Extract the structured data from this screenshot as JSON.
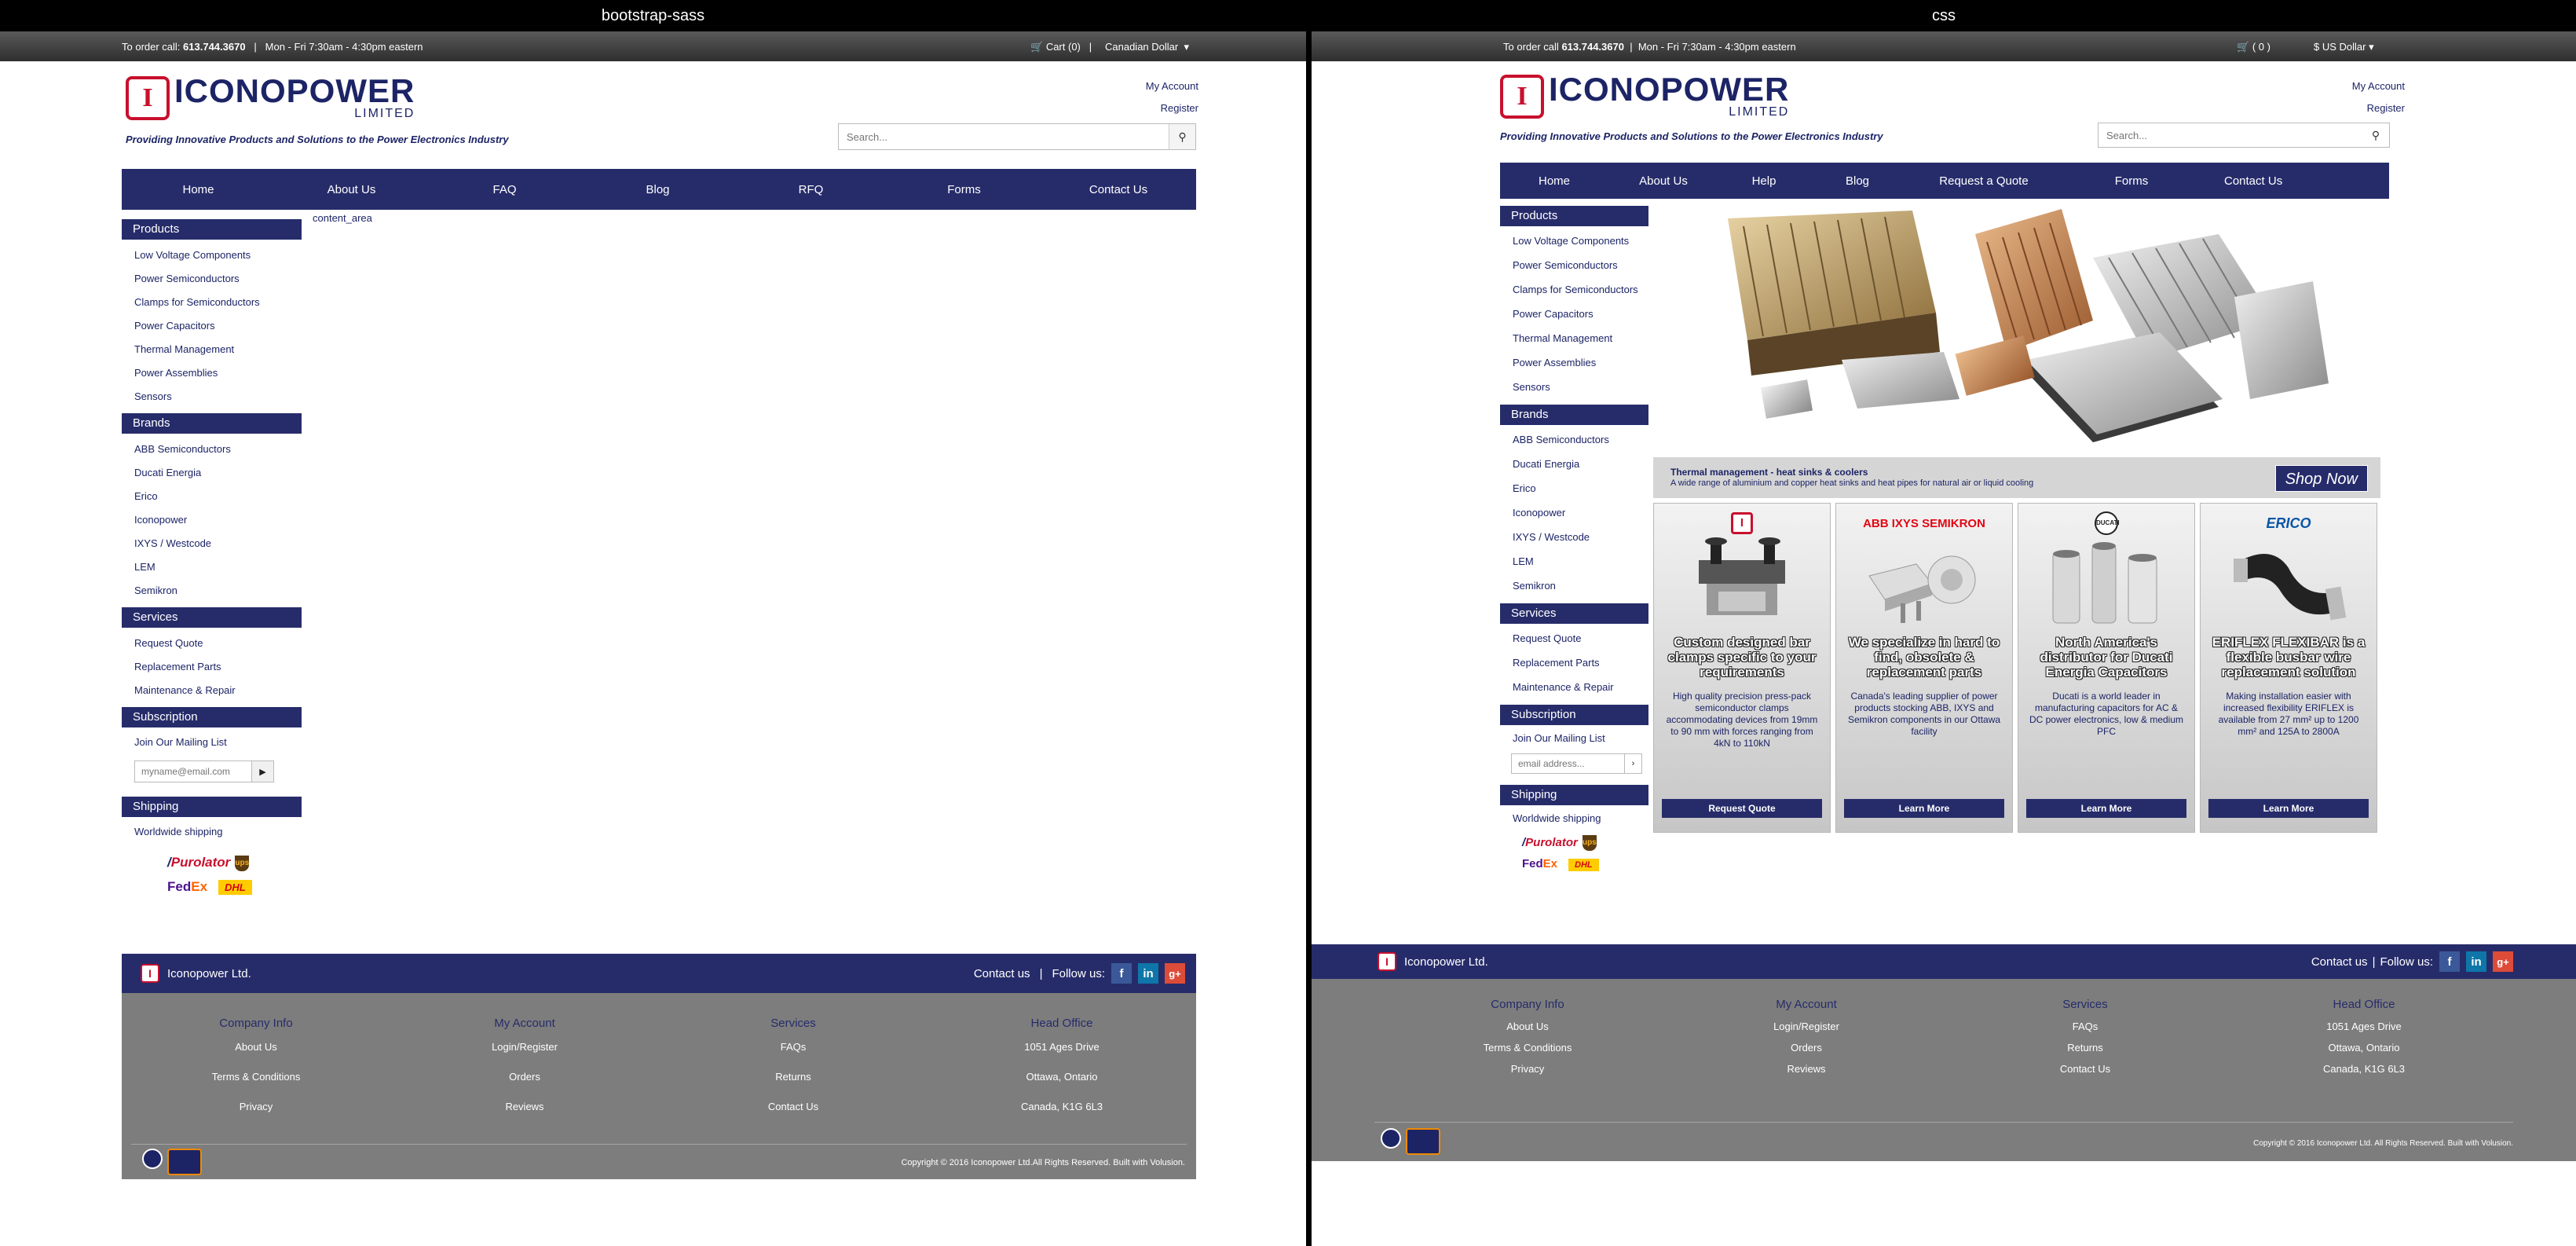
{
  "panels": [
    {
      "caption": "bootstrap-sass",
      "topbar": {
        "order_prefix": "To order call:",
        "phone": "613.744.3670",
        "sep": "|",
        "hours": "Mon - Fri   7:30am - 4:30pm eastern",
        "cart": "Cart (0)",
        "currency": "Canadian Dollar"
      },
      "logo": {
        "name": "ICONOPOWER",
        "sub": "LIMITED"
      },
      "tagline": "Providing Innovative Products and Solutions to the Power Electronics Industry",
      "account": {
        "my_account": "My Account",
        "register": "Register"
      },
      "search_placeholder": "Search...",
      "nav": [
        "Home",
        "About Us",
        "FAQ",
        "Blog",
        "RFQ",
        "Forms",
        "Contact Us"
      ],
      "content_placeholder": "content_area",
      "sidebar": {
        "products_title": "Products",
        "products": [
          "Low Voltage Components",
          "Power Semiconductors",
          "Clamps for Semiconductors",
          "Power Capacitors",
          "Thermal Management",
          "Power Assemblies",
          "Sensors"
        ],
        "brands_title": "Brands",
        "brands": [
          "ABB Semiconductors",
          "Ducati Energia",
          "Erico",
          "Iconopower",
          "IXYS / Westcode",
          "LEM",
          "Semikron"
        ],
        "services_title": "Services",
        "services": [
          "Request Quote",
          "Replacement Parts",
          "Maintenance & Repair"
        ],
        "subscription_title": "Subscription",
        "mailing_list": "Join Our Mailing List",
        "email_placeholder": "myname@email.com",
        "shipping_title": "Shipping",
        "shipping_text": "Worldwide shipping"
      },
      "footer": {
        "company": "Iconopower Ltd.",
        "contact": "Contact us",
        "sep": "|",
        "follow": "Follow us:",
        "columns": [
          {
            "title": "Company Info",
            "items": [
              "About Us",
              "Terms & Conditions",
              "Privacy"
            ]
          },
          {
            "title": "My Account",
            "items": [
              "Login/Register",
              "Orders",
              "Reviews"
            ]
          },
          {
            "title": "Services",
            "items": [
              "FAQs",
              "Returns",
              "Contact Us"
            ]
          },
          {
            "title": "Head Office",
            "items": [
              "1051 Ages Drive",
              "Ottawa, Ontario",
              "Canada, K1G 6L3"
            ]
          }
        ],
        "copyright": "Copyright © 2016 Iconopower Ltd.All Rights Reserved. Built with Volusion."
      }
    },
    {
      "caption": "css",
      "topbar": {
        "order_prefix": "To order call",
        "phone": "613.744.3670",
        "sep": "|",
        "hours": "Mon - Fri   7:30am - 4:30pm eastern",
        "cart": "( 0 )",
        "currency": "US Dollar"
      },
      "logo": {
        "name": "ICONOPOWER",
        "sub": "LIMITED"
      },
      "tagline": "Providing Innovative Products and Solutions to the Power Electronics Industry",
      "account": {
        "my_account": "My Account",
        "register": "Register"
      },
      "search_placeholder": "Search...",
      "nav": [
        "Home",
        "About Us",
        "Help",
        "Blog",
        "Request a Quote",
        "Forms",
        "Contact Us"
      ],
      "sidebar": {
        "products_title": "Products",
        "products": [
          "Low Voltage Components",
          "Power Semiconductors",
          "Clamps for Semiconductors",
          "Power Capacitors",
          "Thermal Management",
          "Power Assemblies",
          "Sensors"
        ],
        "brands_title": "Brands",
        "brands": [
          "ABB Semiconductors",
          "Ducati Energia",
          "Erico",
          "Iconopower",
          "IXYS / Westcode",
          "LEM",
          "Semikron"
        ],
        "services_title": "Services",
        "services": [
          "Request Quote",
          "Replacement Parts",
          "Maintenance & Repair"
        ],
        "subscription_title": "Subscription",
        "mailing_list": "Join Our Mailing List",
        "email_placeholder": "email address...",
        "shipping_title": "Shipping",
        "shipping_text": "Worldwide shipping"
      },
      "promo": {
        "title": "Thermal management - heat sinks & coolers",
        "text": "A wide range of aluminium and copper heat sinks and heat pipes for natural air or liquid cooling",
        "button": "Shop Now"
      },
      "cards": [
        {
          "logo": "I",
          "title": "Custom designed bar clamps specific to your requirements",
          "text": "High quality precision press-pack semiconductor clamps accommodating devices from 19mm to 90 mm with forces ranging from 4kN to 110kN",
          "button": "Request Quote"
        },
        {
          "logo": "ABB IXYS SEMIKRON",
          "title": "We specialize in hard to find, obsolete & replacement parts",
          "text": "Canada's leading supplier of power products stocking ABB, IXYS and Semikron components in our Ottawa facility",
          "button": "Learn More"
        },
        {
          "logo": "DUCATI",
          "title": "North America's distributor for Ducati Energia Capacitors",
          "text": "Ducati is a world leader in manufacturing capacitors for AC & DC power electronics, low & medium PFC",
          "button": "Learn More"
        },
        {
          "logo": "ERICO",
          "title": "ERIFLEX FLEXIBAR is a flexible busbar wire replacement solution",
          "text": "Making installation easier with increased flexibility ERIFLEX is available from 27 mm² up to 1200 mm² and 125A to 2800A",
          "button": "Learn More"
        }
      ],
      "footer": {
        "company": "Iconopower Ltd.",
        "contact": "Contact us",
        "sep": "|",
        "follow": "Follow us:",
        "columns": [
          {
            "title": "Company Info",
            "items": [
              "About Us",
              "Terms & Conditions",
              "Privacy"
            ]
          },
          {
            "title": "My Account",
            "items": [
              "Login/Register",
              "Orders",
              "Reviews"
            ]
          },
          {
            "title": "Services",
            "items": [
              "FAQs",
              "Returns",
              "Contact Us"
            ]
          },
          {
            "title": "Head Office",
            "items": [
              "1051 Ages Drive",
              "Ottawa, Ontario",
              "Canada, K1G 6L3"
            ]
          }
        ],
        "copyright": "Copyright © 2016 Iconopower Ltd. All Rights Reserved. Built with Volusion."
      }
    }
  ],
  "colors": {
    "brand_navy": "#262c6a",
    "logo_red": "#c8102e",
    "footer_gray": "#7d7d7d"
  },
  "icons": [
    "cart-icon",
    "search-icon",
    "dollar-icon",
    "facebook-icon",
    "linkedin-icon",
    "googleplus-icon"
  ]
}
